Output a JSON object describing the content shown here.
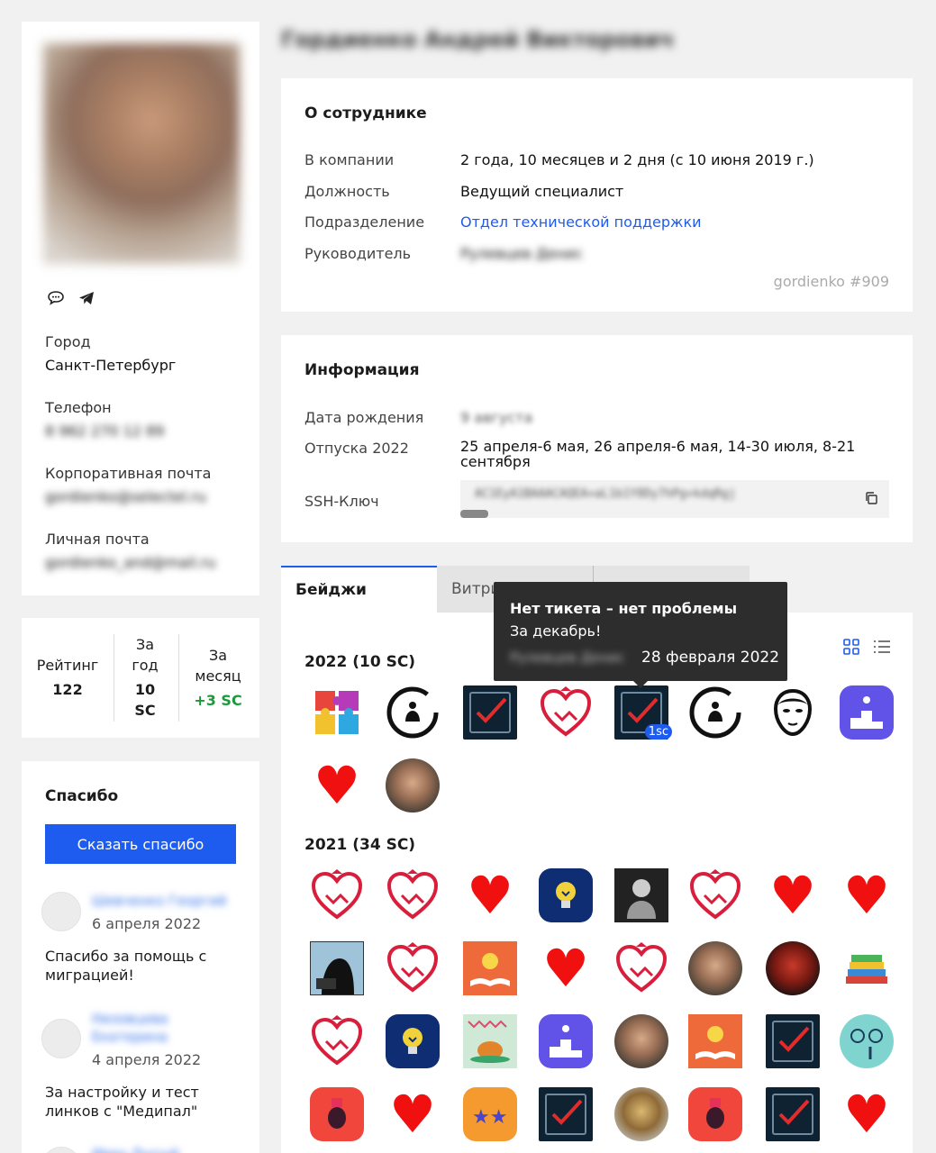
{
  "employee": {
    "name": "Гордиенко Андрей Викторович"
  },
  "left": {
    "city_label": "Город",
    "city": "Санкт-Петербург",
    "phone_label": "Телефон",
    "phone": "8 962 270 12 89",
    "corp_email_label": "Корпоративная почта",
    "corp_email": "gordienko@selectel.ru",
    "personal_email_label": "Личная почта",
    "personal_email": "gordienko_and@mail.ru"
  },
  "rating": {
    "rating_label": "Рейтинг",
    "rating_value": "122",
    "year_label_1": "За",
    "year_label_2": "год",
    "year_value_1": "10",
    "year_value_2": "SC",
    "month_label_1": "За",
    "month_label_2": "месяц",
    "month_value": "+3 SC",
    "accent_green": "#1a9b3a"
  },
  "thanks": {
    "title": "Спасибо",
    "button": "Сказать спасибо",
    "items": [
      {
        "author": "Шевченко Георгий",
        "date": "6 апреля 2022",
        "message": "Спасибо за помощь с миграцией!"
      },
      {
        "author": "Низовцева Екатерина",
        "date": "4 апреля 2022",
        "message": "За настройку и тест линков с \"Медипал\""
      },
      {
        "author": "Иван Лысый"
      }
    ]
  },
  "about": {
    "title": "О сотруднике",
    "rows": [
      {
        "label": "В компании",
        "value": "2 года, 10 месяцев и 2 дня (с 10 июня 2019 г.)"
      },
      {
        "label": "Должность",
        "value": "Ведущий специалист"
      },
      {
        "label": "Подразделение",
        "value": "Отдел технической поддержки"
      },
      {
        "label": "Руководитель",
        "value": "Рулевцев Денис"
      }
    ],
    "user_id": "gordienko #909"
  },
  "info": {
    "title": "Информация",
    "birthday_label": "Дата рождения",
    "birthday": "9 августа",
    "vacation_label": "Отпуска 2022",
    "vacation": "25 апреля-6 мая, 26 апреля-6 мая, 14-30 июля, 8-21 сентября",
    "ssh_label": "SSH-Ключ",
    "ssh_value": "AC1EyA1BAAACAQEA+aL1b1Y8Dy7hPg+kdqRgj"
  },
  "tabs": [
    {
      "label": "Бейджи"
    },
    {
      "label": "Витри"
    },
    {
      "label": ""
    }
  ],
  "badges": {
    "year_2022": "2022 (10 SC)",
    "year_2021": "2021 (34 SC)",
    "counter": "1sc",
    "grid_icon": "grid-view-icon",
    "list_icon": "list-view-icon"
  },
  "tooltip": {
    "title": "Нет тикета – нет проблемы",
    "subtitle": "За декабрь!",
    "author": "Рулевцев Денис",
    "date": "28 февраля 2022"
  }
}
